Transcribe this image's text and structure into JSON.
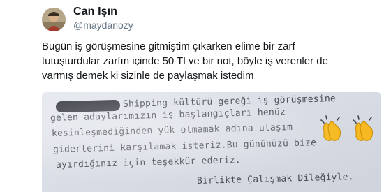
{
  "tweet": {
    "display_name": "Can Işın",
    "handle": "@maydanozy",
    "text_lines": [
      "Bugün iş görüşmesine gitmiştim çıkarken elime bir zarf",
      "tutuşturdular zarfın içinde 50 Tl ve bir not, böyle iş verenler de",
      "varmış demek ki sizinle de paylaşmak istedim"
    ]
  },
  "photo": {
    "note_lines": [
      "Shipping kültürü gereği iş görüşmesine",
      "gelen adaylarımızın iş başlangıçları henüz",
      "kesinleşmediğinden yük olmamak adına ulaşım",
      "giderlerini karşılamak isteriz.Bu gününüzü bize",
      "ayırdığınız için teşekkür ederiz.",
      "Birlikte Çalışmak Dileğiyle."
    ],
    "emoji": [
      "clapping-hands-icon",
      "clapping-hands-icon"
    ]
  },
  "colors": {
    "name": "#14171a",
    "handle": "#657786",
    "paper": "#dde1e8",
    "ink": "#4a4d55",
    "clap": "#f6b921"
  }
}
